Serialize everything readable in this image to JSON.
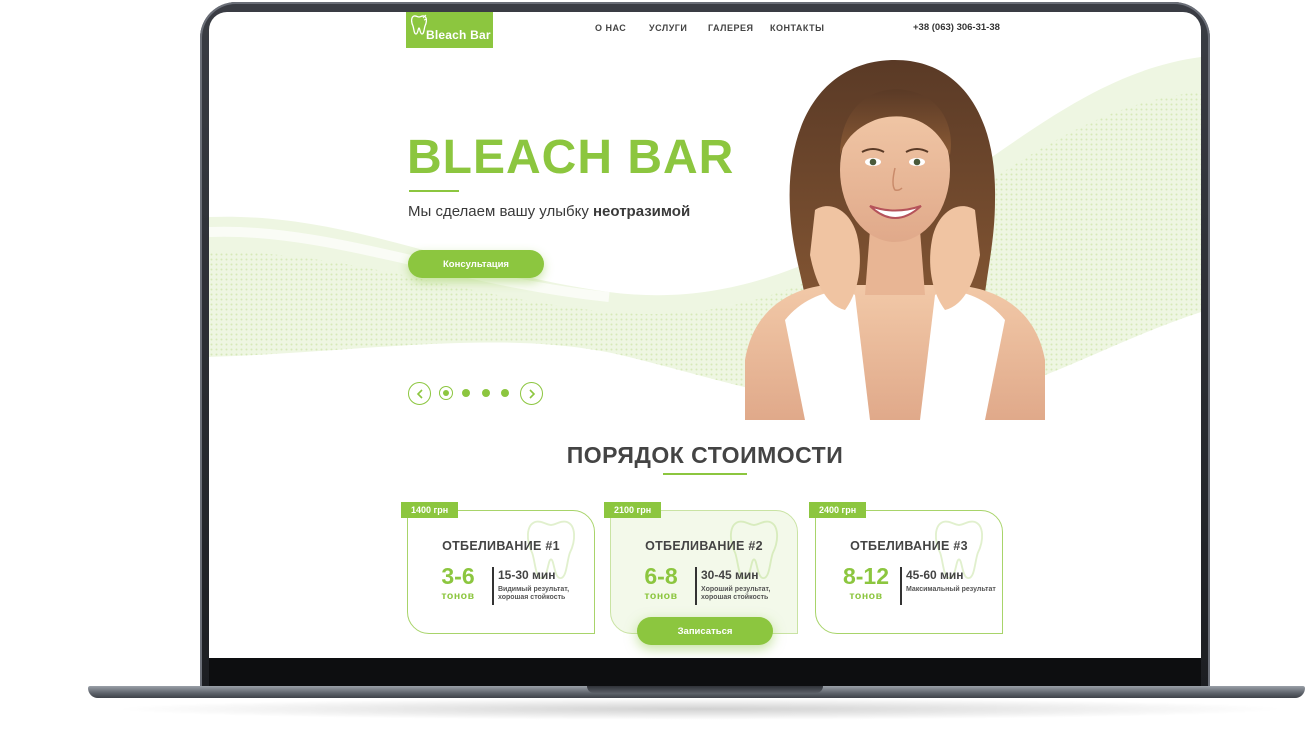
{
  "brand": {
    "name": "Bleach Bar",
    "accent": "#8cc63f",
    "text": "#444444"
  },
  "nav": {
    "items": [
      {
        "label": "О НАС"
      },
      {
        "label": "УСЛУГИ"
      },
      {
        "label": "ГАЛЕРЕЯ"
      },
      {
        "label": "КОНТАКТЫ"
      }
    ],
    "phone": "+38 (063) 306-31-38"
  },
  "hero": {
    "title": "BLEACH BAR",
    "subtitle_regular": "Мы сделаем вашу улыбку ",
    "subtitle_bold": "неотразимой",
    "cta_label": "Консультация",
    "slider": {
      "slides": 4,
      "active_index": 0
    }
  },
  "pricing": {
    "title": "ПОРЯДОК СТОИМОСТИ",
    "cards": [
      {
        "price": "1400 грн",
        "title": "ОТБЕЛИВАНИЕ #1",
        "range": "3-6",
        "unit": "тонов",
        "time": "15-30 мин",
        "desc": "Видимый результат, хорошая стойкость"
      },
      {
        "price": "2100 грн",
        "title": "ОТБЕЛИВАНИЕ #2",
        "range": "6-8",
        "unit": "тонов",
        "time": "30-45 мин",
        "desc": "Хороший результат, хорошая стойкость"
      },
      {
        "price": "2400 грн",
        "title": "ОТБЕЛИВАНИЕ #3",
        "range": "8-12",
        "unit": "тонов",
        "time": "45-60 мин",
        "desc": "Максимальный результат"
      }
    ],
    "signup_label": "Записаться"
  }
}
